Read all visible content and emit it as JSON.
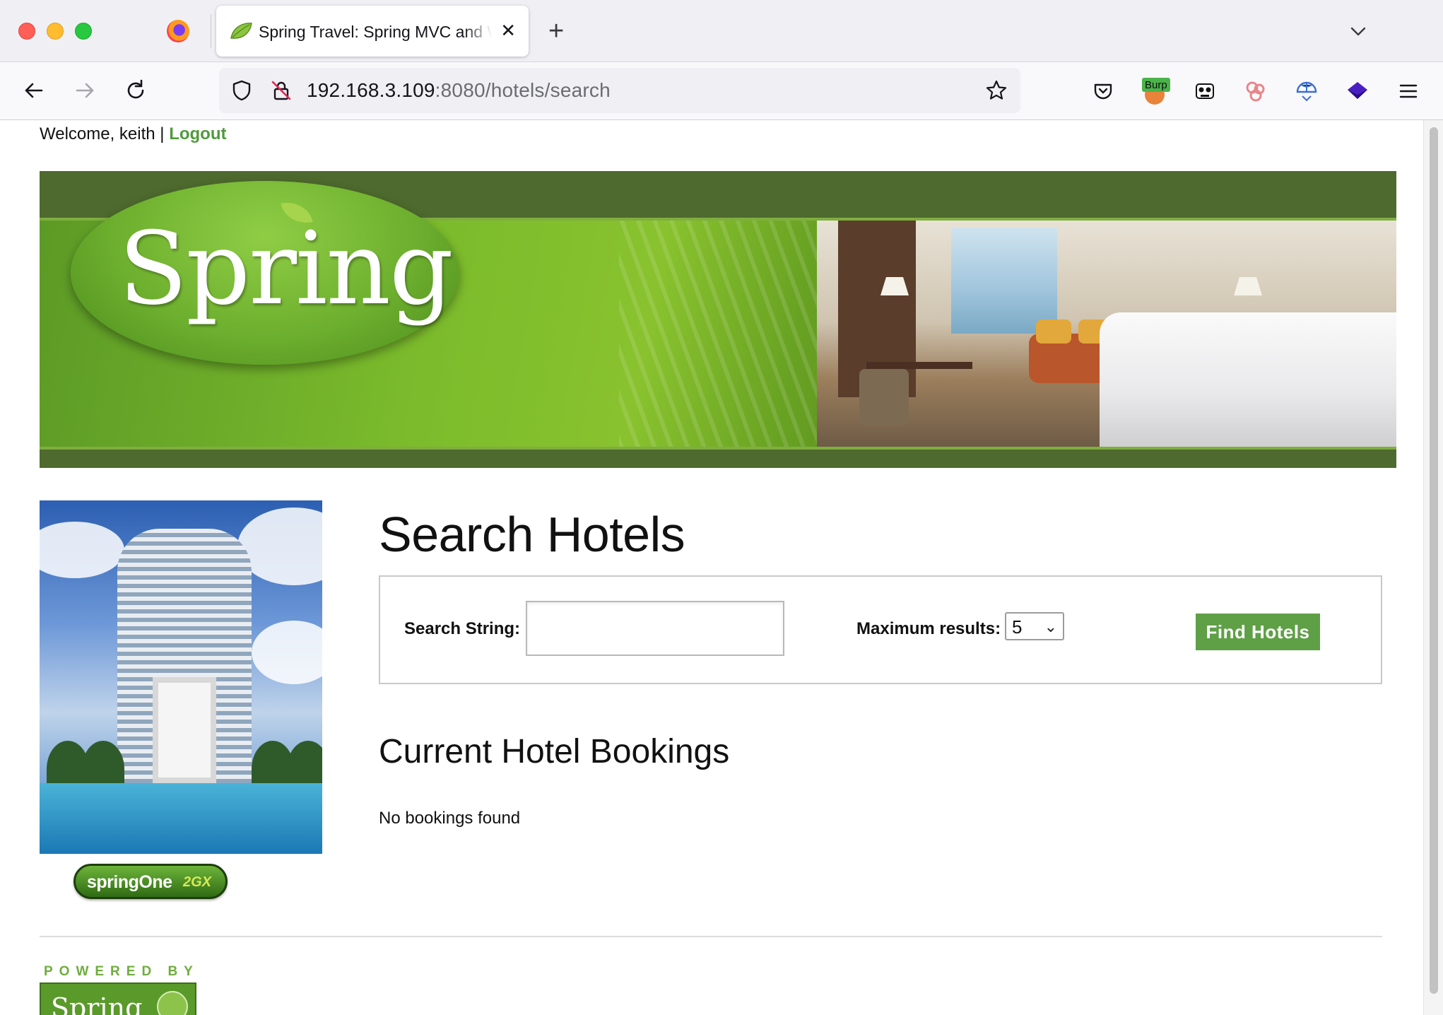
{
  "browser": {
    "tab_title": "Spring Travel: Spring MVC and Web Flow Reference Application",
    "close_glyph": "✕",
    "newtab_glyph": "+",
    "url_host": "192.168.3.109",
    "url_rest": ":8080/hotels/search",
    "extensions": [
      {
        "name": "pocket-icon"
      },
      {
        "name": "burp-extension-icon",
        "label": "Burp"
      },
      {
        "name": "panda-extension-icon"
      },
      {
        "name": "cookie-extension-icon"
      },
      {
        "name": "globe-extension-icon"
      },
      {
        "name": "cube-extension-icon"
      }
    ]
  },
  "page": {
    "welcome_prefix": "Welcome, keith | ",
    "logout_label": "Logout",
    "banner_logo_text": "Spring",
    "springone_text": "springOne",
    "springone_suffix": "2GX",
    "title": "Search Hotels",
    "search": {
      "string_label": "Search String:",
      "string_value": "",
      "max_label": "Maximum results:",
      "max_value": "5",
      "submit_label": "Find Hotels"
    },
    "bookings_title": "Current Hotel Bookings",
    "bookings_empty": "No bookings found",
    "footer": {
      "powered_by": "POWERED BY",
      "logo_text": "Spring"
    }
  },
  "colors": {
    "accent_green": "#5fa047",
    "link_green": "#4f9a3c"
  }
}
